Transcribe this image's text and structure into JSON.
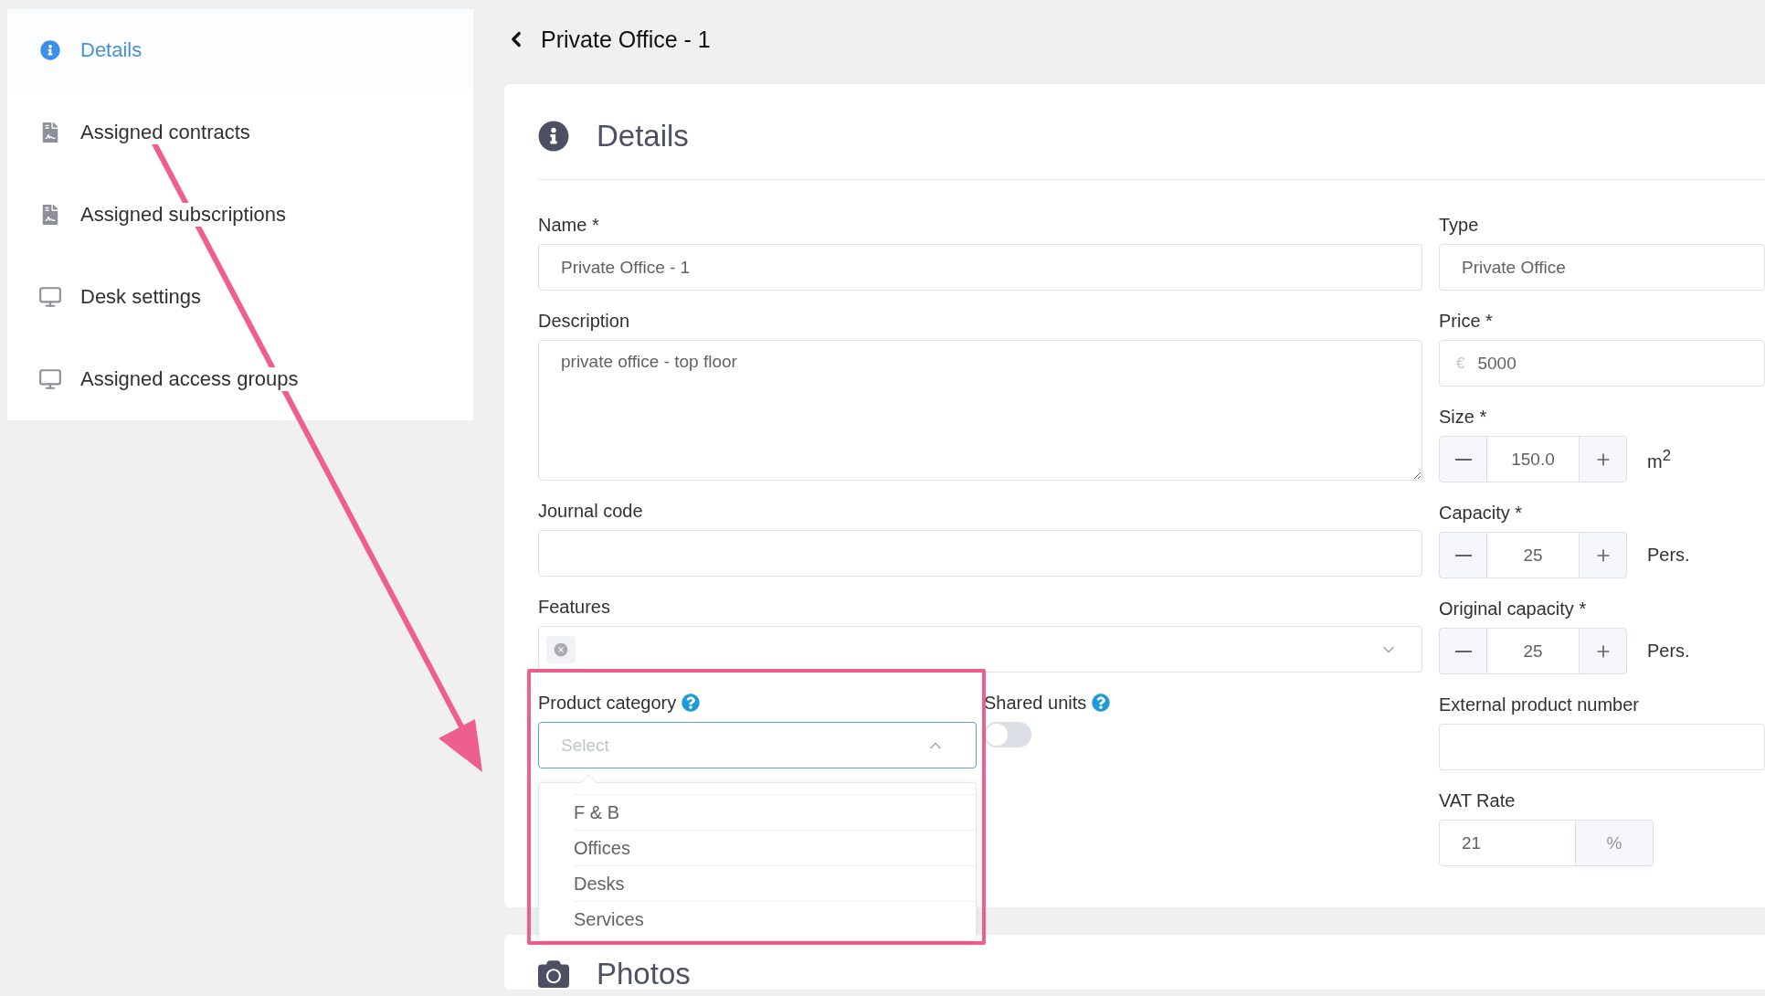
{
  "sidebar": {
    "items": [
      {
        "label": "Details",
        "kind": "info",
        "selected": true
      },
      {
        "label": "Assigned contracts",
        "kind": "document",
        "selected": false
      },
      {
        "label": "Assigned subscriptions",
        "kind": "document",
        "selected": false
      },
      {
        "label": "Desk settings",
        "kind": "monitor",
        "selected": false
      },
      {
        "label": "Assigned access groups",
        "kind": "monitor",
        "selected": false
      }
    ]
  },
  "header": {
    "title": "Private Office - 1"
  },
  "details": {
    "title": "Details",
    "left_fields": [
      {
        "kind": "text",
        "label": "Name *",
        "value": "Private Office - 1"
      },
      {
        "kind": "textarea",
        "label": "Description",
        "value": "private office - top floor"
      },
      {
        "kind": "text",
        "label": "Journal code"
      },
      {
        "kind": "tags",
        "label": "Features"
      }
    ],
    "product_category": {
      "label": "Product category",
      "placeholder": "Select",
      "expanded": true,
      "options": [
        {
          "label": "F & B",
          "selected": false
        },
        {
          "label": "Offices",
          "selected": false
        },
        {
          "label": "Desks",
          "selected": false
        },
        {
          "label": "Services",
          "selected": false
        }
      ]
    },
    "shared_units": {
      "label": "Shared units",
      "on": false
    },
    "right_fields": [
      {
        "kind": "text",
        "label": "Type",
        "value": "Private Office"
      },
      {
        "kind": "prefixed",
        "label": "Price *",
        "prefix": "€",
        "value": "5000"
      },
      {
        "kind": "stepper",
        "label": "Size *",
        "value": "150.0",
        "unit": "m$^{2}$"
      },
      {
        "kind": "stepper",
        "label": "Capacity *",
        "value": "25",
        "unit": "Pers."
      },
      {
        "kind": "stepper",
        "label": "Original capacity *",
        "value": "25",
        "unit": "Pers."
      },
      {
        "kind": "text",
        "label": "External product number"
      },
      {
        "kind": "suffixed",
        "label": "VAT Rate",
        "value": "21",
        "suffix": "%"
      }
    ]
  },
  "photos": {
    "title": "Photos"
  }
}
